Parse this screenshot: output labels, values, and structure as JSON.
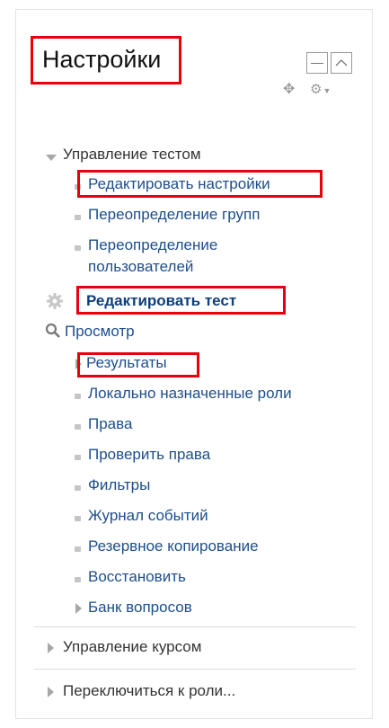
{
  "block": {
    "title": "Настройки",
    "items": {
      "quiz_admin": "Управление тестом",
      "edit_settings": "Редактировать настройки",
      "group_overrides": "Переопределение групп",
      "user_overrides_1": "Переопределение",
      "user_overrides_2": "пользователей",
      "edit_quiz": "Редактировать тест",
      "preview": "Просмотр",
      "results": "Результаты",
      "local_roles": "Локально назначенные роли",
      "permissions": "Права",
      "check_permissions": "Проверить права",
      "filters": "Фильтры",
      "logs": "Журнал событий",
      "backup": "Резервное копирование",
      "restore": "Восстановить",
      "question_bank": "Банк вопросов",
      "course_admin": "Управление курсом",
      "switch_role": "Переключиться к роли..."
    }
  }
}
